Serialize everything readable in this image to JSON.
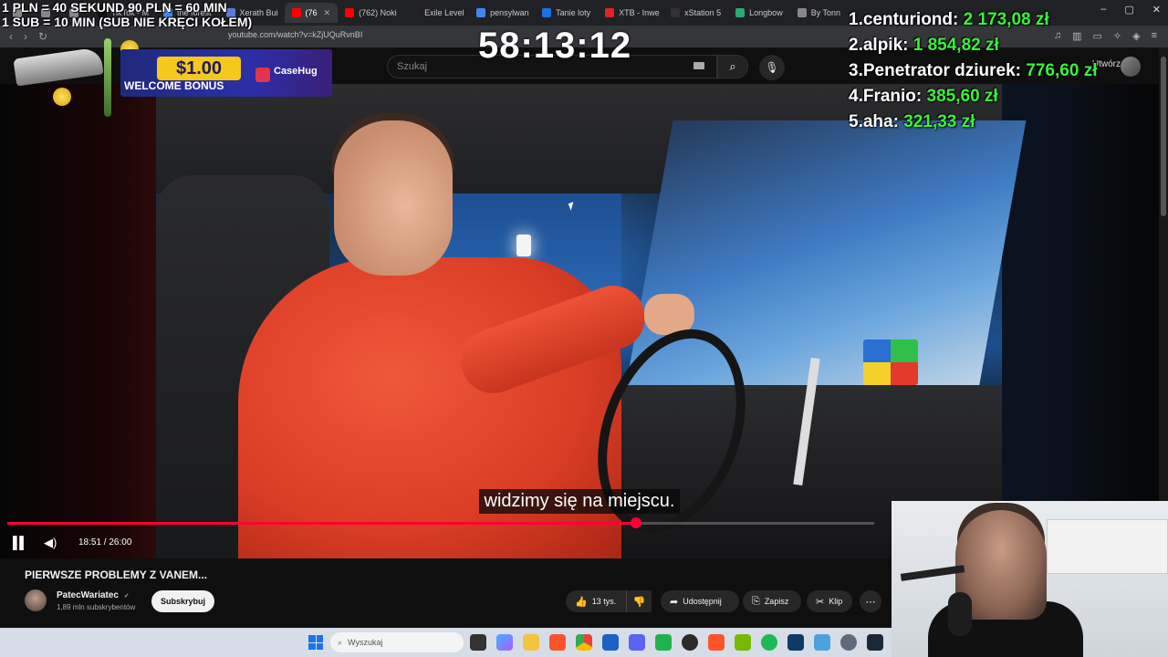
{
  "browser": {
    "tabs": [
      {
        "label": "",
        "color": "#888888"
      },
      {
        "label": "",
        "color": "#888888"
      },
      {
        "label": "",
        "color": "#888888"
      },
      {
        "label": "TikTok - M",
        "color": "#111111"
      },
      {
        "label": "the forest",
        "color": "#4285f4"
      },
      {
        "label": "Xerath Bui",
        "color": "#5b7bd5"
      },
      {
        "label": "(76",
        "color": "#ff0000",
        "active": true
      },
      {
        "label": "(762) Noki",
        "color": "#ff0000"
      },
      {
        "label": "Exile Level",
        "color": "#222222"
      },
      {
        "label": "pensylwan",
        "color": "#4285f4"
      },
      {
        "label": "Tanie loty",
        "color": "#1a73e8"
      },
      {
        "label": "XTB - Inwe",
        "color": "#e02424"
      },
      {
        "label": "xStation 5",
        "color": "#333333"
      },
      {
        "label": "Longbow",
        "color": "#2aa876"
      },
      {
        "label": "By Tonn",
        "color": "#888888"
      }
    ],
    "url": "youtube.com/watch?v=kZjUQuRvnBI",
    "window_controls": [
      "–",
      "▢",
      "✕"
    ]
  },
  "youtube": {
    "search_placeholder": "Szukaj",
    "header_right": "Utwórz",
    "video": {
      "subtitle": "widzimy się na miejscu.",
      "time": "18:51 / 26:00",
      "progress": 0.725
    },
    "title": "PIERWSZE PROBLEMY Z VANEM...",
    "channel": {
      "name": "PatecWariatec",
      "verified": "✓",
      "subscribers": "1,89 mln subskrybentów",
      "subscribe_label": "Subskrybuj"
    },
    "actions": {
      "likes": "13 tys.",
      "share": "Udostępnij",
      "save": "Zapisz",
      "clip": "Klip"
    }
  },
  "overlay": {
    "rates_line1": "1 PLN =  40 SEKUND 90 PLN = 60 MIN",
    "rates_line2": "1 SUB = 10 MIN (SUB NIE KRĘCI KOŁEM)",
    "timer": "58:13:12",
    "promo": {
      "amount": "$1.00",
      "text": "WELCOME BONUS",
      "brand": "CaseHug"
    },
    "leaderboard": [
      {
        "rank": "1.",
        "name": "centuriond:",
        "amount": "2 173,08 zł"
      },
      {
        "rank": "2.",
        "name": "alpik:",
        "amount": "1 854,82 zł"
      },
      {
        "rank": "3.",
        "name": "Penetrator dziurek:",
        "amount": "776,60 zł"
      },
      {
        "rank": "4.",
        "name": "Franio:",
        "amount": "385,60 zł"
      },
      {
        "rank": "5.",
        "name": "aha:",
        "amount": "321,33 zł"
      }
    ]
  },
  "taskbar": {
    "search_label": "Wyszukaj"
  }
}
